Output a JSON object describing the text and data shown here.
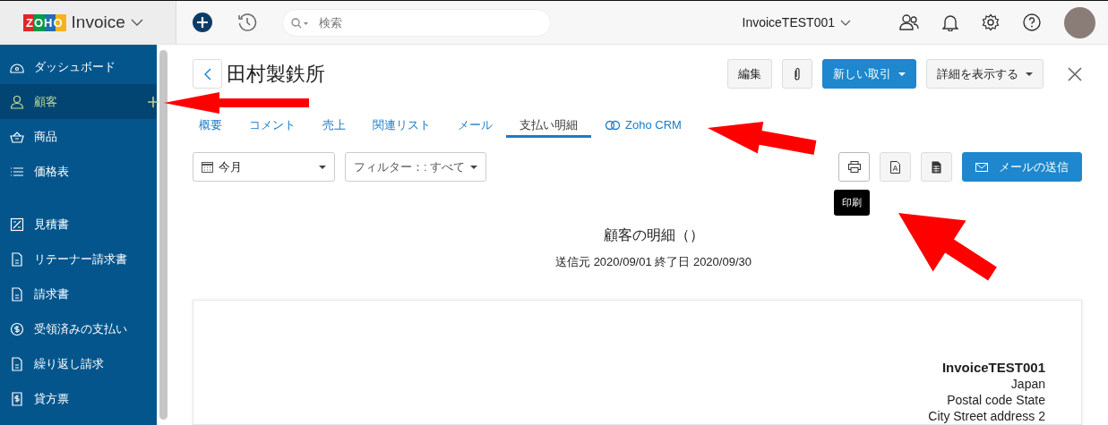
{
  "app": {
    "logo": "ZOHO",
    "name": "Invoice"
  },
  "topbar": {
    "search": {
      "placeholder": "検索"
    },
    "org": "InvoiceTEST001"
  },
  "sidebar": {
    "groups": [
      {
        "items": [
          {
            "label": "ダッシュボード",
            "selected": false
          },
          {
            "label": "顧客",
            "selected": true
          },
          {
            "label": "商品",
            "selected": false
          },
          {
            "label": "価格表",
            "selected": false
          }
        ]
      },
      {
        "items": [
          {
            "label": "見積書",
            "selected": false
          },
          {
            "label": "リテーナー請求書",
            "selected": false
          },
          {
            "label": "請求書",
            "selected": false
          },
          {
            "label": "受領済みの支払い",
            "selected": false
          },
          {
            "label": "繰り返し請求",
            "selected": false
          },
          {
            "label": "貸方票",
            "selected": false
          }
        ]
      }
    ]
  },
  "page": {
    "title": "田村製鉄所",
    "actions": {
      "edit": "編集",
      "new": "新しい取引",
      "more": "詳細を表示する"
    },
    "tabs": [
      {
        "label": "概要",
        "selected": false
      },
      {
        "label": "コメント",
        "selected": false
      },
      {
        "label": "売上",
        "selected": false
      },
      {
        "label": "関連リスト",
        "selected": false
      },
      {
        "label": "メール",
        "selected": false
      },
      {
        "label": "支払い明細",
        "selected": true
      },
      {
        "label": "Zoho CRM",
        "selected": false
      }
    ],
    "period": "今月",
    "filter": "フィルター：: すべて",
    "tooltip": "印刷",
    "send_mail": "メールの送信",
    "statement": {
      "title": "顧客の明細（）",
      "range": "送信元 2020/09/01 終了日 2020/09/30",
      "org": "InvoiceTEST001",
      "address": [
        "Japan",
        "Postal code State",
        "City Street address 2"
      ]
    }
  }
}
